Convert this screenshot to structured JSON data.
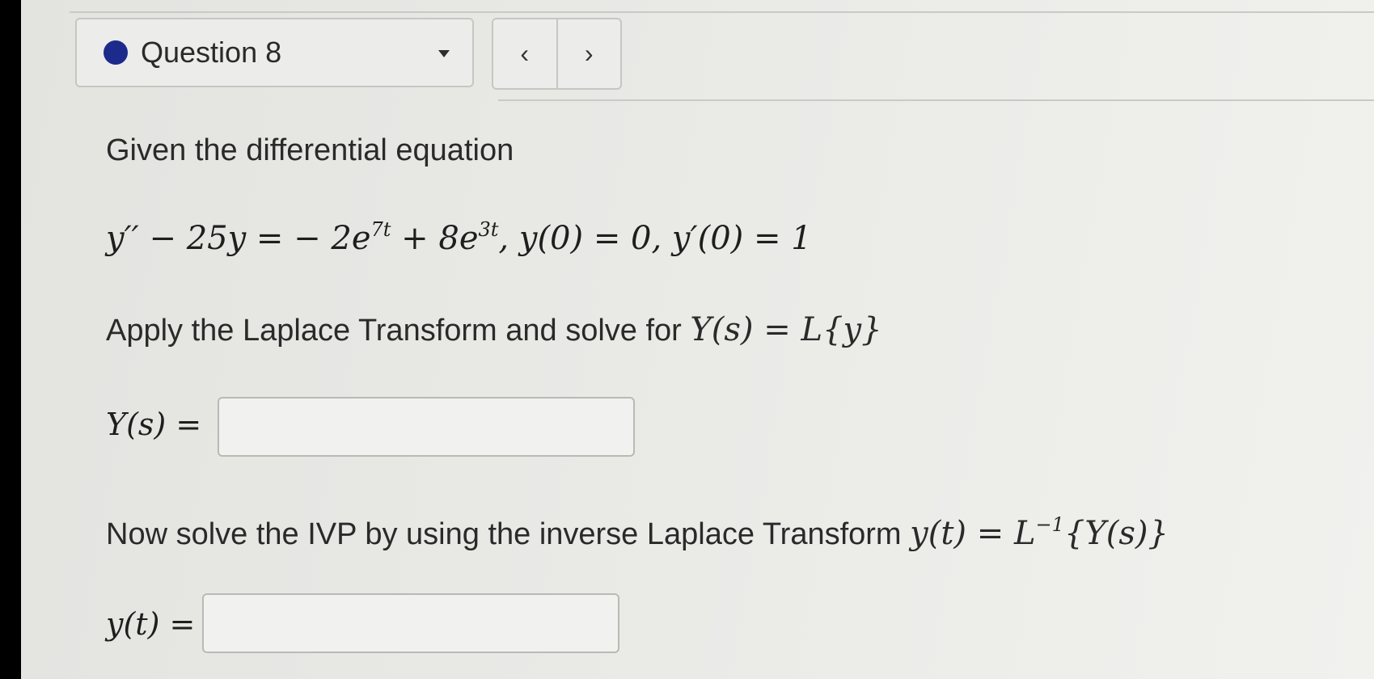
{
  "header": {
    "question_label": "Question 8",
    "status_color": "#1c2a8c",
    "dropdown_icon": "triangle-down-icon",
    "prev_label": "‹",
    "next_label": "›"
  },
  "question": {
    "intro": "Given the differential equation",
    "equation": {
      "lhs": "y′′ − 25y = − 2e",
      "exp1": "7t",
      "mid": " + 8e",
      "exp2": "3t",
      "conditions": ",  y(0) = 0,  y′(0) = 1"
    },
    "laplace_prompt": "Apply the Laplace Transform and solve for ",
    "laplace_expr": "Y(s) = L{y}",
    "Y_label": "Y(s) =",
    "Y_value": "",
    "inverse_prompt": "Now solve the IVP by using the inverse Laplace Transform ",
    "inverse_expr_pre": "y(t) = L",
    "inverse_expr_sup": "−1",
    "inverse_expr_post": "{Y(s)}",
    "y_label": "y(t) =",
    "y_value": ""
  }
}
